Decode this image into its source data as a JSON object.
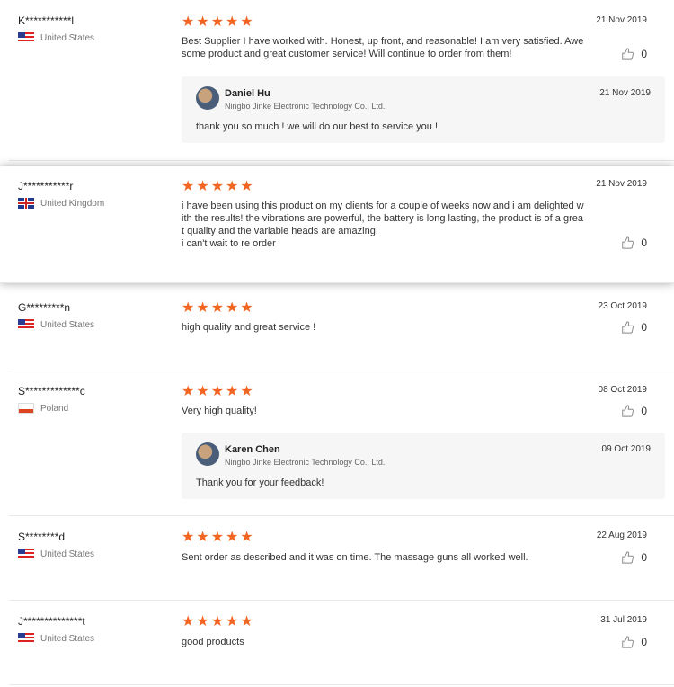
{
  "reviews": [
    {
      "name": "K***********l",
      "country": "United States",
      "flag": "us",
      "rating": 5,
      "text": "Best Supplier I have worked with. Honest, up front, and reasonable! I am very satisfied. Awe\nsome product and great customer service! Will continue to order from them!",
      "date": "21 Nov 2019",
      "likes": "0",
      "reply": {
        "name": "Daniel Hu",
        "company": "Ningbo Jinke Electronic Technology Co., Ltd.",
        "date": "21 Nov 2019",
        "text": "thank you so much ! we will do our best to service you !"
      }
    },
    {
      "name": "J***********r",
      "country": "United Kingdom",
      "flag": "uk",
      "rating": 5,
      "text": "i have been using this product on my clients for a couple of weeks now and i am delighted w\nith the results! the vibrations are powerful, the battery is long lasting, the product is of a grea\nt quality and the variable heads are amazing!\ni can't wait to re order",
      "date": "21 Nov 2019",
      "likes": "0"
    },
    {
      "name": "G*********n",
      "country": "United States",
      "flag": "us",
      "rating": 5,
      "text": "high quality and great service !",
      "date": "23 Oct 2019",
      "likes": "0"
    },
    {
      "name": "S*************c",
      "country": "Poland",
      "flag": "pl",
      "rating": 5,
      "text": "Very high quality!",
      "date": "08 Oct 2019",
      "likes": "0",
      "reply": {
        "name": "Karen Chen",
        "company": "Ningbo Jinke Electronic Technology Co., Ltd.",
        "date": "09 Oct 2019",
        "text": "Thank you for your feedback!"
      }
    },
    {
      "name": "S********d",
      "country": "United States",
      "flag": "us",
      "rating": 5,
      "text": "Sent order as described and it was on time. The massage guns all worked well.",
      "date": "22 Aug 2019",
      "likes": "0"
    },
    {
      "name": "J**************t",
      "country": "United States",
      "flag": "us",
      "rating": 5,
      "text": "good products",
      "date": "31 Jul 2019",
      "likes": "0"
    }
  ],
  "icons": {
    "star": "star-icon",
    "like": "thumbs-up-icon"
  },
  "colors": {
    "star": "#f26522"
  }
}
